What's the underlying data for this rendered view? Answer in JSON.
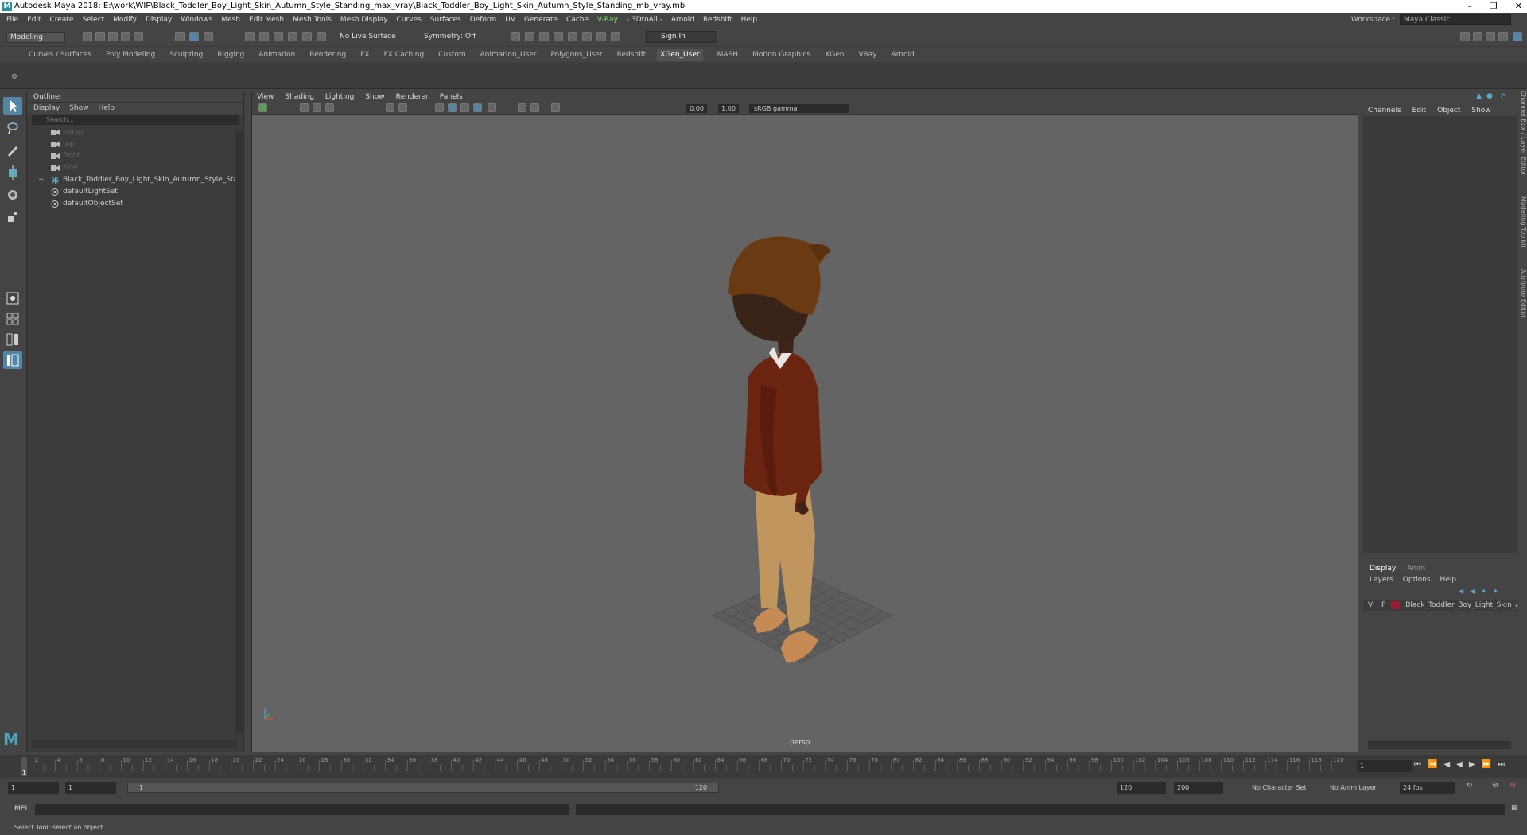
{
  "window": {
    "title": "Autodesk Maya 2018: E:\\work\\WIP\\Black_Toddler_Boy_Light_Skin_Autumn_Style_Standing_max_vray\\Black_Toddler_Boy_Light_Skin_Autumn_Style_Standing_mb_vray.mb",
    "logo": "M"
  },
  "menubar": [
    "File",
    "Edit",
    "Create",
    "Select",
    "Modify",
    "Display",
    "Windows",
    "Mesh",
    "Edit Mesh",
    "Mesh Tools",
    "Mesh Display",
    "Curves",
    "Surfaces",
    "Deform",
    "UV",
    "Generate",
    "Cache",
    "V-Ray",
    "- 3DtoAll -",
    "Arnold",
    "Redshift",
    "Help"
  ],
  "workspace": {
    "label": "Workspace :",
    "value": "Maya Classic"
  },
  "statusline": {
    "mode": "Modeling",
    "live_surface": "No Live Surface",
    "symmetry": "Symmetry: Off",
    "sign_in": "Sign In"
  },
  "shelf_tabs": [
    "Curves / Surfaces",
    "Poly Modeling",
    "Sculpting",
    "Rigging",
    "Animation",
    "Rendering",
    "FX",
    "FX Caching",
    "Custom",
    "Animation_User",
    "Polygons_User",
    "Redshift",
    "XGen_User",
    "MASH",
    "Motion Graphics",
    "XGen",
    "VRay",
    "Arnold"
  ],
  "shelf_active": "XGen_User",
  "outliner": {
    "title": "Outliner",
    "menu": [
      "Display",
      "Show",
      "Help"
    ],
    "search_placeholder": "Search...",
    "items": [
      {
        "label": "persp",
        "dim": true
      },
      {
        "label": "top",
        "dim": true
      },
      {
        "label": "front",
        "dim": true
      },
      {
        "label": "side",
        "dim": true
      },
      {
        "label": "Black_Toddler_Boy_Light_Skin_Autumn_Style_Standing_n",
        "dim": false
      },
      {
        "label": "defaultLightSet",
        "dim": false
      },
      {
        "label": "defaultObjectSet",
        "dim": false
      }
    ]
  },
  "viewport": {
    "menu": [
      "View",
      "Shading",
      "Lighting",
      "Show",
      "Renderer",
      "Panels"
    ],
    "exposure": "0.00",
    "gamma_value": "1.00",
    "color_space": "sRGB gamma",
    "camera_label": "persp"
  },
  "channel_box": {
    "menu": [
      "Channels",
      "Edit",
      "Object",
      "Show"
    ],
    "layer_tabs": [
      "Display",
      "Anim"
    ],
    "layer_menu": [
      "Layers",
      "Options",
      "Help"
    ],
    "layer": {
      "v": "V",
      "p": "P",
      "name": "Black_Toddler_Boy_Light_Skin_Autu",
      "color": "#9b1c31"
    }
  },
  "side_tabs": [
    "Channel Box / Layer Editor",
    "Modeling Toolkit",
    "Attribute Editor"
  ],
  "timeline": {
    "ticks": [
      "2",
      "4",
      "6",
      "8",
      "10",
      "12",
      "14",
      "16",
      "18",
      "20",
      "22",
      "24",
      "26",
      "28",
      "30",
      "32",
      "34",
      "36",
      "38",
      "40",
      "42",
      "44",
      "46",
      "48",
      "50",
      "52",
      "54",
      "56",
      "58",
      "60",
      "62",
      "64",
      "66",
      "68",
      "70",
      "72",
      "74",
      "76",
      "78",
      "80",
      "82",
      "84",
      "86",
      "88",
      "90",
      "92",
      "94",
      "96",
      "98",
      "100",
      "102",
      "104",
      "106",
      "108",
      "110",
      "112",
      "114",
      "116",
      "118",
      "120"
    ],
    "current_frame": "1",
    "current_field": "1"
  },
  "range": {
    "start": "1",
    "start2": "1",
    "slider_start": "1",
    "slider_end": "120",
    "end": "120",
    "end2": "200",
    "character_set": "No Character Set",
    "anim_layer": "No Anim Layer",
    "fps": "24 fps"
  },
  "command_line": {
    "label": "MEL"
  },
  "help_line": "Select Tool: select an object"
}
